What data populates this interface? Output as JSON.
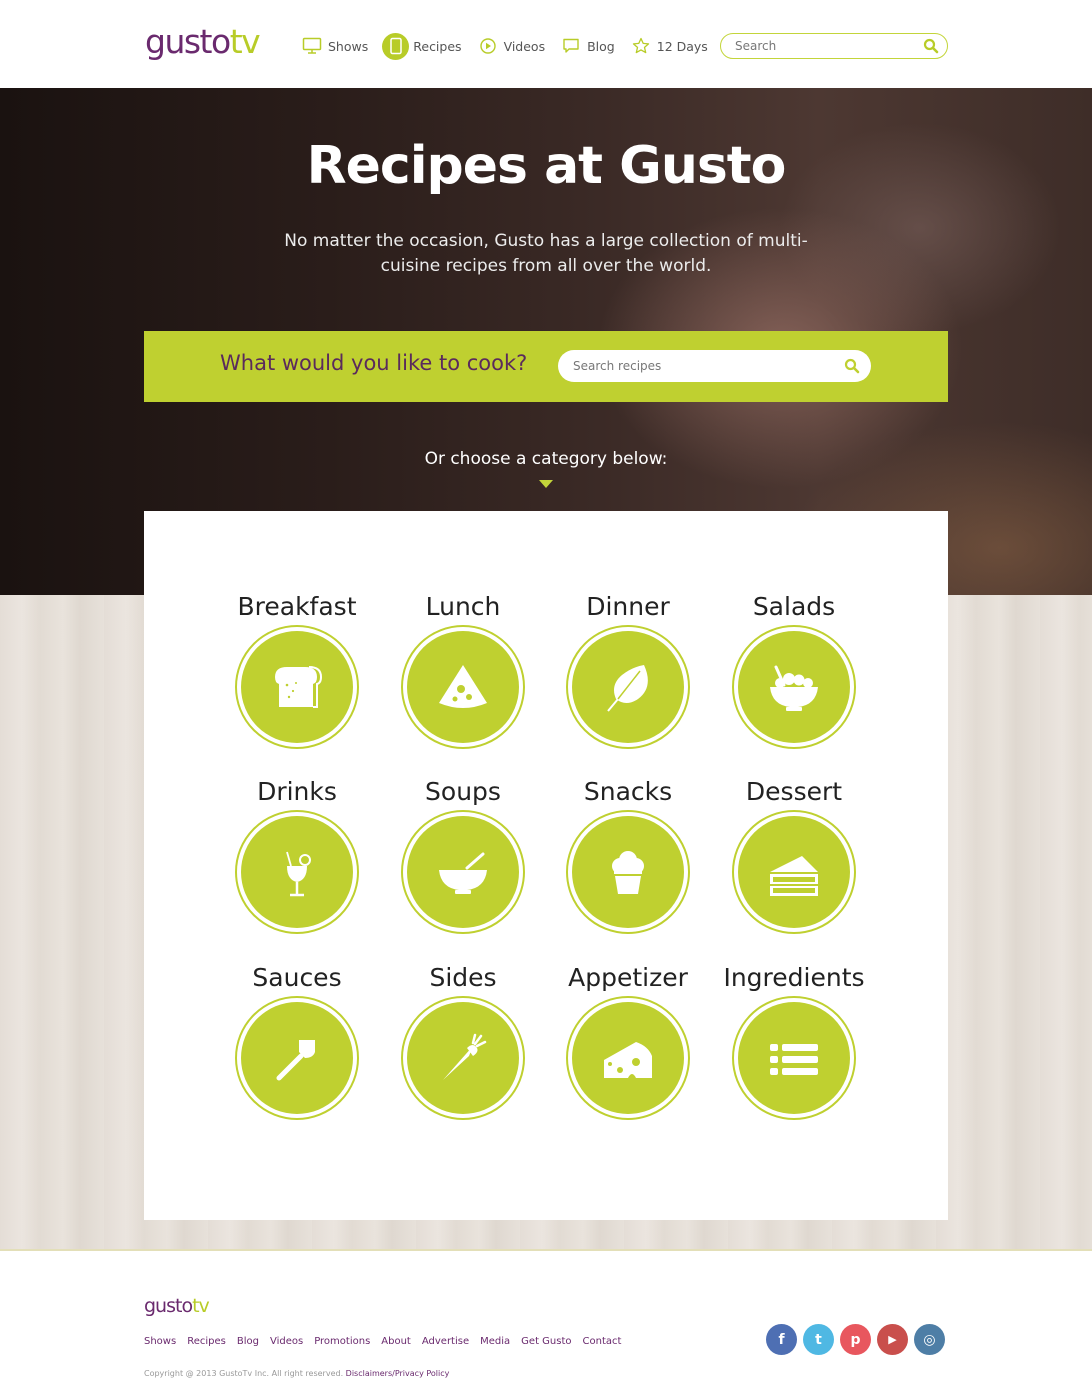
{
  "header": {
    "logo": {
      "part1": "gusto",
      "part2": "tv"
    },
    "nav": [
      {
        "label": "Shows",
        "icon": "tv-icon"
      },
      {
        "label": "Recipes",
        "icon": "tablet-icon",
        "active": true
      },
      {
        "label": "Videos",
        "icon": "play-icon"
      },
      {
        "label": "Blog",
        "icon": "speech-bubble-icon"
      },
      {
        "label": "12 Days",
        "icon": "star-icon"
      }
    ],
    "search_placeholder": "Search"
  },
  "hero": {
    "title": "Recipes at Gusto",
    "subtitle": "No matter the occasion, Gusto has a large collection of multi-cuisine recipes from all over the world.",
    "cook_question": "What would you like to cook?",
    "cook_search_placeholder": "Search recipes",
    "choose_text": "Or choose a category below:"
  },
  "categories": [
    {
      "label": "Breakfast",
      "icon": "bread-icon"
    },
    {
      "label": "Lunch",
      "icon": "pizza-slice-icon"
    },
    {
      "label": "Dinner",
      "icon": "leaf-icon"
    },
    {
      "label": "Salads",
      "icon": "salad-bowl-icon"
    },
    {
      "label": "Drinks",
      "icon": "cocktail-icon"
    },
    {
      "label": "Soups",
      "icon": "soup-bowl-icon"
    },
    {
      "label": "Snacks",
      "icon": "muffin-icon"
    },
    {
      "label": "Dessert",
      "icon": "cake-slice-icon"
    },
    {
      "label": "Sauces",
      "icon": "spatula-icon"
    },
    {
      "label": "Sides",
      "icon": "carrot-icon"
    },
    {
      "label": "Appetizer",
      "icon": "cheese-icon"
    },
    {
      "label": "Ingredients",
      "icon": "list-icon"
    }
  ],
  "footer": {
    "logo": {
      "part1": "gusto",
      "part2": "tv"
    },
    "links": [
      "Shows",
      "Recipes",
      "Blog",
      "Videos",
      "Promotions",
      "About",
      "Advertise",
      "Media",
      "Get Gusto",
      "Contact"
    ],
    "copyright": "Copyright @ 2013 GustoTv Inc. All right reserved.",
    "disclaimer": "Disclaimers/Privacy Policy",
    "social": [
      {
        "name": "facebook-icon",
        "glyph": "f",
        "color": "#4e6fb3"
      },
      {
        "name": "twitter-icon",
        "glyph": "t",
        "color": "#4fb8e3"
      },
      {
        "name": "pinterest-icon",
        "glyph": "p",
        "color": "#e8575e"
      },
      {
        "name": "youtube-icon",
        "glyph": "▶",
        "color": "#c94f4c"
      },
      {
        "name": "instagram-icon",
        "glyph": "◎",
        "color": "#4e7ea6"
      }
    ]
  },
  "colors": {
    "accent": "#bfd030",
    "brand_purple": "#6a2a6e"
  }
}
